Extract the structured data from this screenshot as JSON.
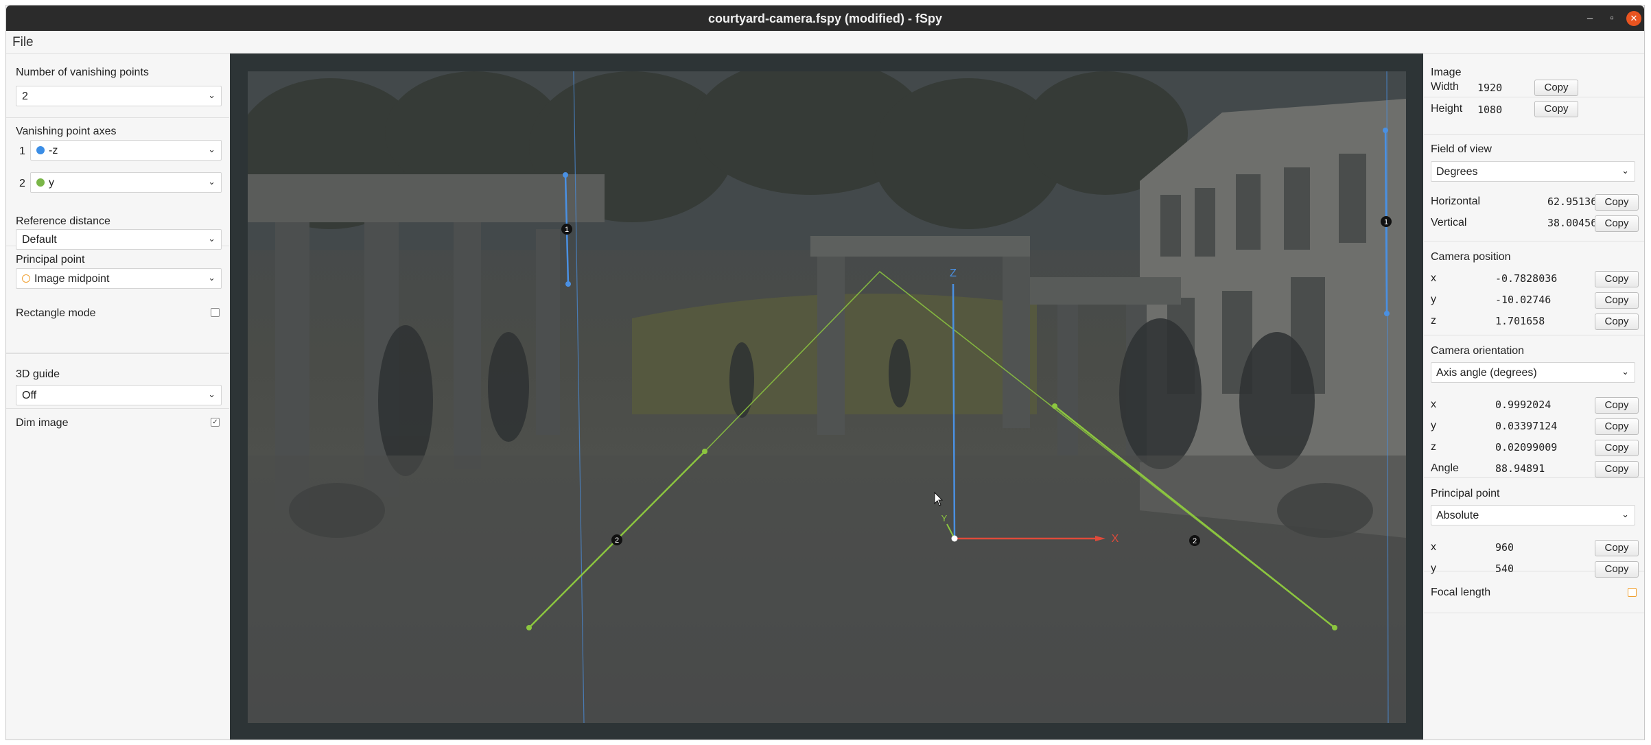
{
  "window": {
    "title": "courtyard-camera.fspy (modified) - fSpy"
  },
  "menu": {
    "file": "File"
  },
  "left": {
    "num_vp_label": "Number of vanishing points",
    "num_vp_value": "2",
    "vp_axes_label": "Vanishing point axes",
    "axes": [
      {
        "index": "1",
        "value": "-z",
        "color": "#3b8ee6"
      },
      {
        "index": "2",
        "value": "y",
        "color": "#7ab648"
      }
    ],
    "ref_distance_label": "Reference distance",
    "ref_distance_value": "Default",
    "principal_point_label": "Principal point",
    "principal_point_value": "Image midpoint",
    "rect_mode_label": "Rectangle mode",
    "rect_mode_checked": false,
    "guide_label": "3D guide",
    "guide_value": "Off",
    "dim_label": "Dim image",
    "dim_checked": true,
    "checkmark": "✓"
  },
  "canvas": {
    "axis_x_label": "X",
    "axis_y_label": "Y",
    "axis_z_label": "Z",
    "vp1_label": "1",
    "vp2_label": "2",
    "colors": {
      "vp1": "#4a90e2",
      "vp2": "#8cc63f",
      "x_axis": "#e04a3a",
      "z_axis": "#4a90e2",
      "y_axis": "#8cc63f"
    }
  },
  "right": {
    "image_header": "Image",
    "width_label": "Width",
    "width_value": "1920",
    "height_label": "Height",
    "height_value": "1080",
    "fov_header": "Field of view",
    "fov_unit": "Degrees",
    "horizontal_label": "Horizontal",
    "horizontal_value": "62.95136",
    "vertical_label": "Vertical",
    "vertical_value": "38.00456",
    "cam_pos_header": "Camera position",
    "pos_x_label": "x",
    "pos_x_value": "-0.7828036",
    "pos_y_label": "y",
    "pos_y_value": "-10.02746",
    "pos_z_label": "z",
    "pos_z_value": "1.701658",
    "orient_header": "Camera orientation",
    "orient_mode": "Axis angle (degrees)",
    "or_x_label": "x",
    "or_x_value": "0.9992024",
    "or_y_label": "y",
    "or_y_value": "0.03397124",
    "or_z_label": "z",
    "or_z_value": "0.02099009",
    "angle_label": "Angle",
    "angle_value": "88.94891",
    "pp_header": "Principal point",
    "pp_mode": "Absolute",
    "pp_x_label": "x",
    "pp_x_value": "960",
    "pp_y_label": "y",
    "pp_y_value": "540",
    "focal_label": "Focal length",
    "copy_label": "Copy"
  }
}
